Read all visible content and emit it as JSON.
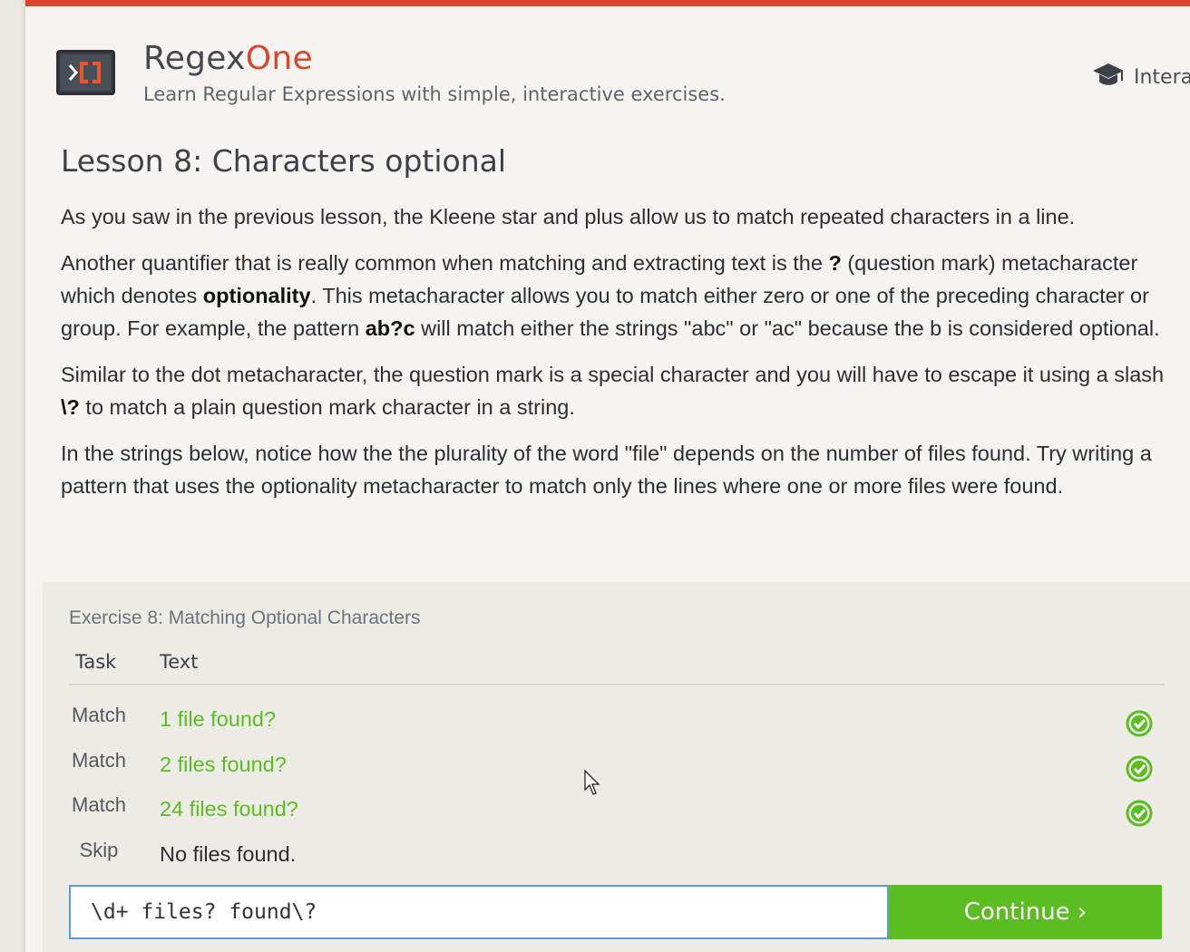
{
  "header": {
    "brand_main": "Regex",
    "brand_accent": "One",
    "tagline": "Learn Regular Expressions with simple, interactive exercises.",
    "nav_link": "Intera",
    "nav_icon": "graduation-cap-icon",
    "accent_color": "#d9472a"
  },
  "lesson": {
    "title": "Lesson 8: Characters optional",
    "p1": "As you saw in the previous lesson, the Kleene star and plus allow us to match repeated characters in a line.",
    "p2_a": "Another quantifier that is really common when matching and extracting text is the ",
    "p2_b": "?",
    "p2_c": " (question mark) metacharacter which denotes ",
    "p2_d": "optionality",
    "p2_e": ". This metacharacter allows you to match either zero or one of the preceding character or group. For example, the pattern ",
    "p2_f": "ab?c",
    "p2_g": " will match either the strings \"abc\" or \"ac\" because the b is considered optional.",
    "p3_a": "Similar to the dot metacharacter, the question mark is a special character and you will have to escape it using a slash ",
    "p3_b": "\\?",
    "p3_c": " to match a plain question mark character in a string.",
    "p4": "In the strings below, notice how the the plurality of the word \"file\" depends on the number of files found. Try writing a pattern that uses the optionality metacharacter to match only the lines where one or more files were found."
  },
  "exercise": {
    "title": "Exercise 8: Matching Optional Characters",
    "col_task": "Task",
    "col_text": "Text",
    "rows": [
      {
        "task": "Match",
        "text": "1 file found?",
        "status": "check-circle-icon"
      },
      {
        "task": "Match",
        "text": "2 files found?",
        "status": "check-circle-icon"
      },
      {
        "task": "Match",
        "text": "24 files found?",
        "status": "check-circle-icon"
      },
      {
        "task": "Skip",
        "text": "No files found.",
        "status": ""
      }
    ],
    "input_value": "\\d+ files? found\\?",
    "continue_label": "Continue ›",
    "success_color": "#5bbd22"
  }
}
